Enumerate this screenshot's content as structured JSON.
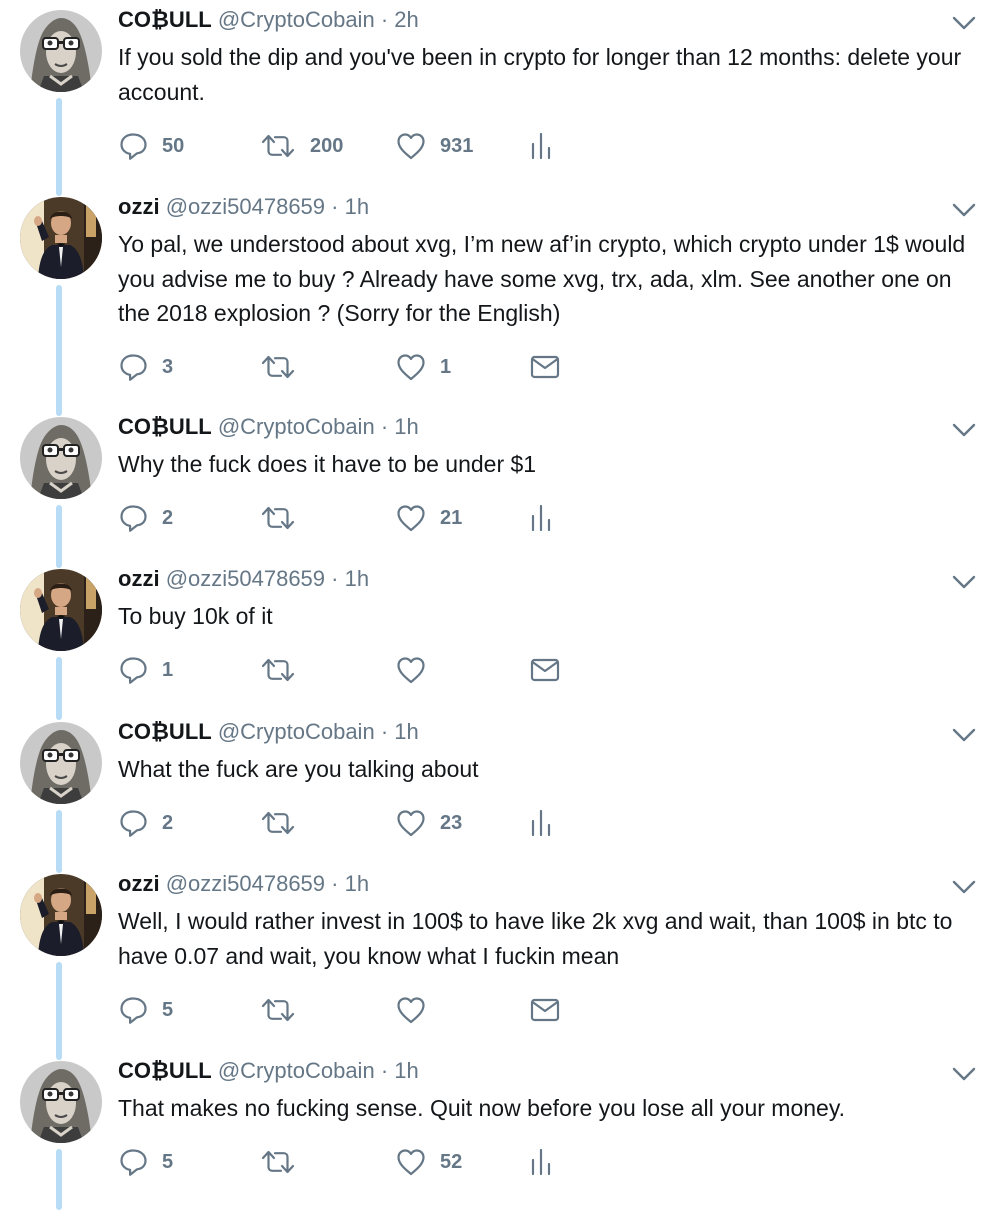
{
  "colors": {
    "thread_line": "#b8dcf5",
    "muted": "#657786",
    "text": "#14171a"
  },
  "icons": {
    "reply": "reply-icon",
    "retweet": "retweet-icon",
    "like": "heart-icon",
    "analytics": "analytics-icon",
    "message": "envelope-icon",
    "menu": "chevron-down-icon"
  },
  "tweets": [
    {
      "name": "CO₿ULL",
      "handle": "@CryptoCobain",
      "dot": "·",
      "time": "2h",
      "text": "If you sold the dip and you've been in crypto for longer than 12 months: delete your account.",
      "replies": "50",
      "retweets": "200",
      "likes": "931"
    },
    {
      "name": "ozzi",
      "handle": "@ozzi50478659",
      "dot": "·",
      "time": "1h",
      "text": "Yo pal, we understood about xvg, I’m new af’in crypto, which crypto under 1$ would you advise me to buy ? Already have some xvg, trx, ada, xlm. See another one on the 2018 explosion ? (Sorry for the English)",
      "replies": "3",
      "retweets": "",
      "likes": "1"
    },
    {
      "name": "CO₿ULL",
      "handle": "@CryptoCobain",
      "dot": "·",
      "time": "1h",
      "text": "Why the fuck does it have to be under $1",
      "replies": "2",
      "retweets": "",
      "likes": "21"
    },
    {
      "name": "ozzi",
      "handle": "@ozzi50478659",
      "dot": "·",
      "time": "1h",
      "text": "To buy 10k of it",
      "replies": "1",
      "retweets": "",
      "likes": ""
    },
    {
      "name": "CO₿ULL",
      "handle": "@CryptoCobain",
      "dot": "·",
      "time": "1h",
      "text": "What the fuck are you talking about",
      "replies": "2",
      "retweets": "",
      "likes": "23"
    },
    {
      "name": "ozzi",
      "handle": "@ozzi50478659",
      "dot": "·",
      "time": "1h",
      "text": "Well, I would rather invest in 100$ to have  like 2k xvg and wait, than 100$ in btc to have 0.07 and wait, you know what I fuckin mean",
      "replies": "5",
      "retweets": "",
      "likes": ""
    },
    {
      "name": "CO₿ULL",
      "handle": "@CryptoCobain",
      "dot": "·",
      "time": "1h",
      "text": "That makes no fucking sense. Quit now before you lose all your money.",
      "replies": "5",
      "retweets": "",
      "likes": "52"
    }
  ]
}
